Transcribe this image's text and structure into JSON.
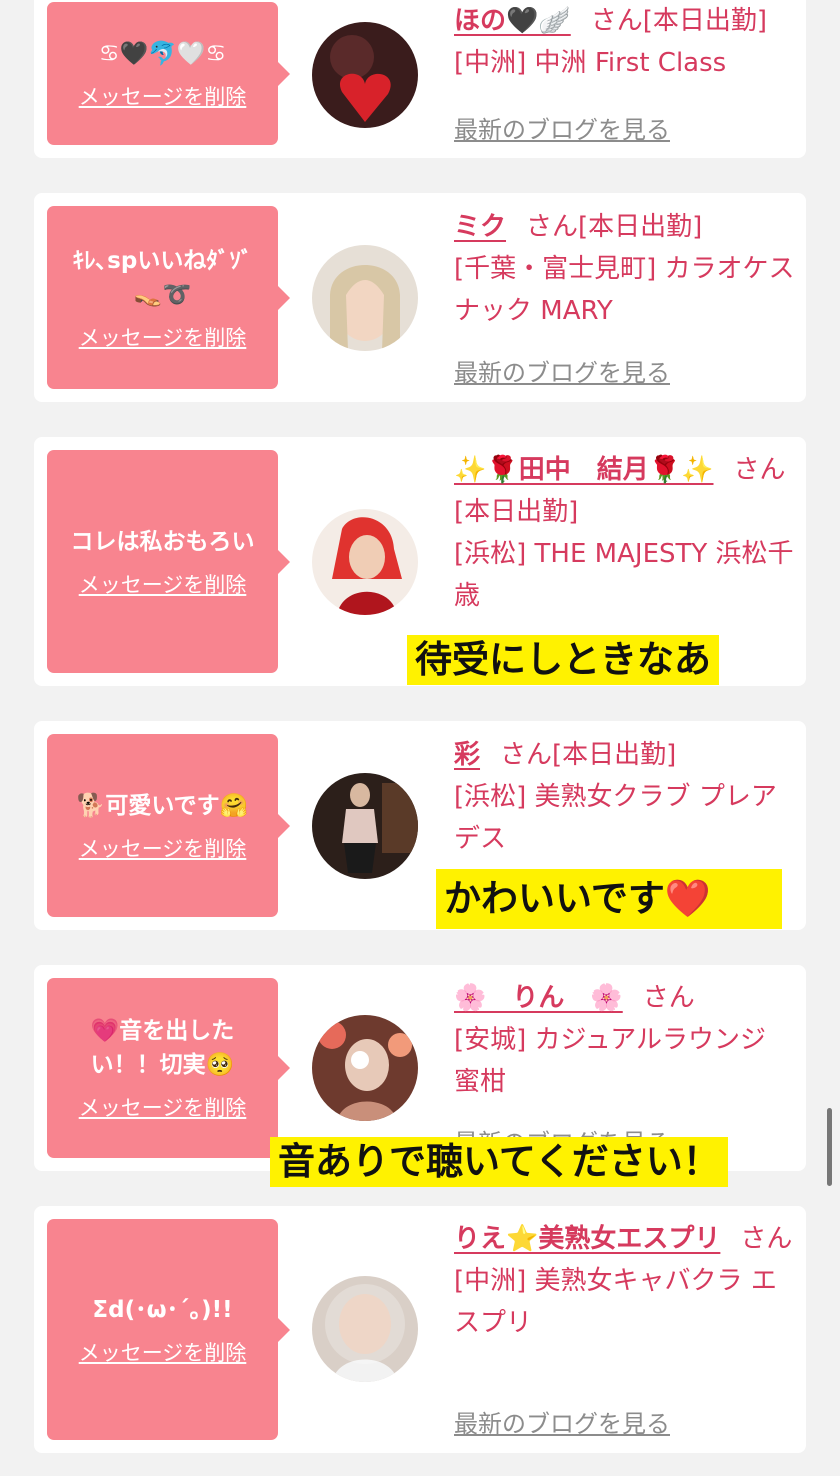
{
  "colors": {
    "accent": "#d63a5e",
    "bubble": "#f8848f",
    "caption_bg": "#fff200",
    "blog_link": "#8c8c8c"
  },
  "delete_label": "メッセージを削除",
  "blog_label": "最新のブログを見る",
  "entries": [
    {
      "message": "♋🖤🐬🤍♋",
      "name": "ほの🖤🪽",
      "suffix": "さん[本日出勤]",
      "shop": "[中洲] 中洲 First Class"
    },
    {
      "message": "ｷﾚ､spいいねﾀﾞｿﾞ 👡➰",
      "name": "ミク",
      "suffix": "さん[本日出勤]",
      "shop": "[千葉・富士見町] カラオケスナック MARY"
    },
    {
      "message": "コレは私おもろい",
      "name": "✨🌹田中　結月🌹✨",
      "suffix": "さん[本日出勤]",
      "shop": "[浜松] THE MAJESTY 浜松千歳",
      "caption": "待受にしときなあ"
    },
    {
      "message": "🐕可愛いです🤗",
      "name": "彩",
      "suffix": "さん[本日出勤]",
      "shop": "[浜松] 美熟女クラブ プレアデス",
      "caption": "かわいいです❤️"
    },
    {
      "message": "💗音を出したい！！切実🥺",
      "name": "🌸　りん　🌸",
      "suffix": "さん",
      "shop": "[安城] カジュアルラウンジ　蜜柑",
      "caption": "音ありで聴いてください！"
    },
    {
      "message": "Σd(･ω･´｡)!!",
      "name": "りえ⭐美熟女エスプリ",
      "suffix": "さん",
      "shop": "[中洲] 美熟女キャバクラ エスプリ"
    }
  ]
}
